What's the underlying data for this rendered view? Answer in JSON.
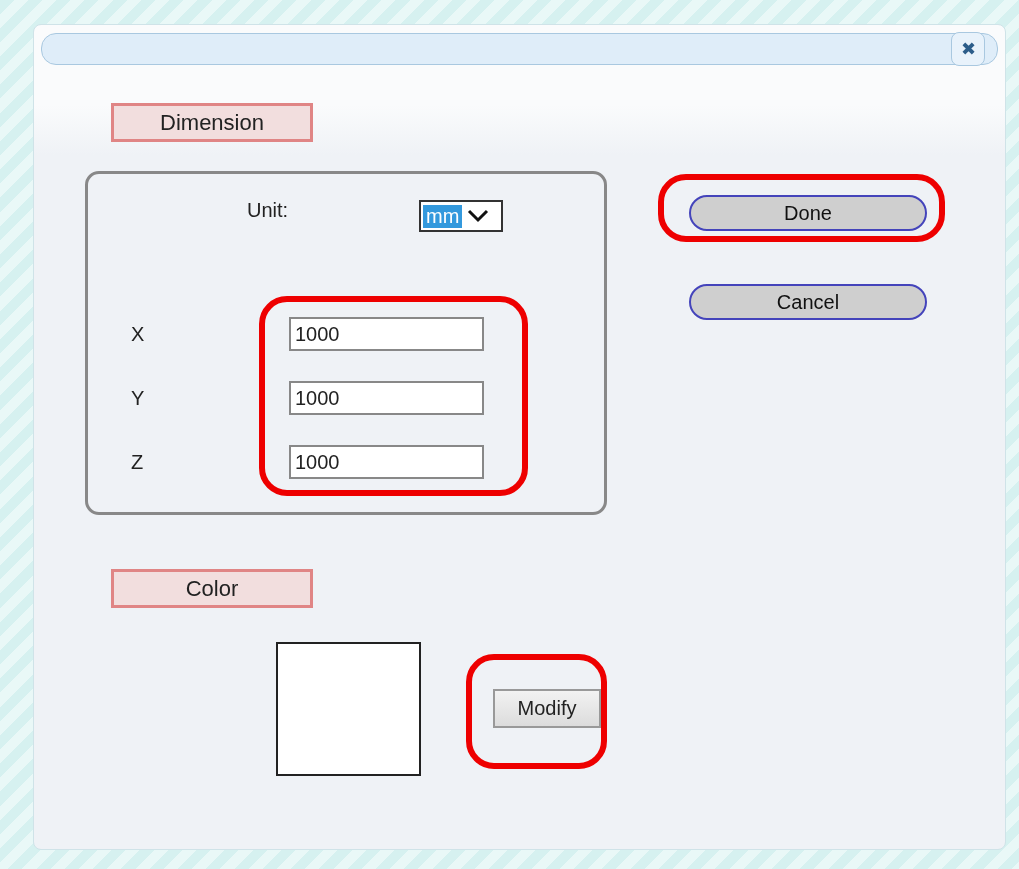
{
  "window": {
    "close": "✖"
  },
  "dimension": {
    "heading": "Dimension",
    "unit": {
      "label": "Unit:",
      "value": "mm",
      "focused": true
    },
    "highlighted": true,
    "fields": [
      {
        "label": "X",
        "value": "1000"
      },
      {
        "label": "Y",
        "value": "1000"
      },
      {
        "label": "Z",
        "value": "1000"
      }
    ]
  },
  "buttons": [
    {
      "label": "Done",
      "highlighted": true
    },
    {
      "label": "Cancel",
      "highlighted": false
    }
  ],
  "color_section": {
    "heading": "Color",
    "color": "#ffffff",
    "button": {
      "label": "Modify",
      "highlighted": true
    }
  }
}
